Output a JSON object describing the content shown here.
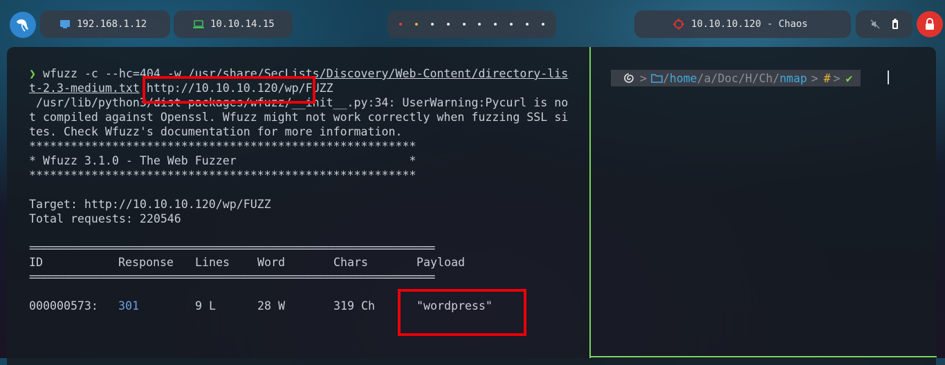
{
  "topbar": {
    "host_ip": "192.168.1.12",
    "vpn_ip": "10.10.14.15",
    "target": "10.10.10.120 - Chaos",
    "dot_colors": [
      "#e63b3b",
      "#e8b23a",
      "#e8e8e8",
      "#e8e8e8",
      "#e8e8e8",
      "#e8e8e8",
      "#e8e8e8",
      "#e8e8e8",
      "#e8e8e8",
      "#e8e8e8"
    ],
    "icons": [
      "kali-dragon-icon",
      "monitor-icon",
      "laptop-icon",
      "target-icon",
      "volume-muted-icon",
      "battery-icon",
      "lock-icon"
    ]
  },
  "terminal": {
    "prompt_symbol": "❯",
    "cmd_prefix": "wfuzz -c --hc=404 -w ",
    "cmd_wordlist_1": "/usr/share/SecLists/Discovery/Web-Content/directory-lis",
    "cmd_wordlist_2": "t-2.3-medium.txt",
    "cmd_url": " http://10.10.10.120/wp/FUZZ",
    "warn_1": " /usr/lib/python3/dist-packages/wfuzz/__init__.py:34: UserWarning:Pycurl is no",
    "warn_2": "t compiled against Openssl. Wfuzz might not work correctly when fuzzing SSL si",
    "warn_3": "tes. Check Wfuzz's documentation for more information.",
    "stars": "********************************************************",
    "banner": "* Wfuzz 3.1.0 - The Web Fuzzer                         *",
    "target_line": "Target: http://10.10.10.120/wp/FUZZ",
    "total_line": "Total requests: 220546",
    "rule": "=====================================================================",
    "headers": {
      "id": "ID",
      "response": "Response",
      "lines": "Lines",
      "word": "Word",
      "chars": "Chars",
      "payload": "Payload"
    },
    "result": {
      "id": "000000573:",
      "response": "301",
      "lines": "9 L",
      "word": "28 W",
      "chars": "319 Ch",
      "payload": "\"wordpress\""
    }
  },
  "right_prompt": {
    "sep": "/",
    "path_home": "home",
    "path_a": "a",
    "path_doc": "Doc",
    "path_h": "H",
    "path_ch": "Ch",
    "path_nmap": "nmap",
    "hash": "#",
    "check": "✔"
  }
}
